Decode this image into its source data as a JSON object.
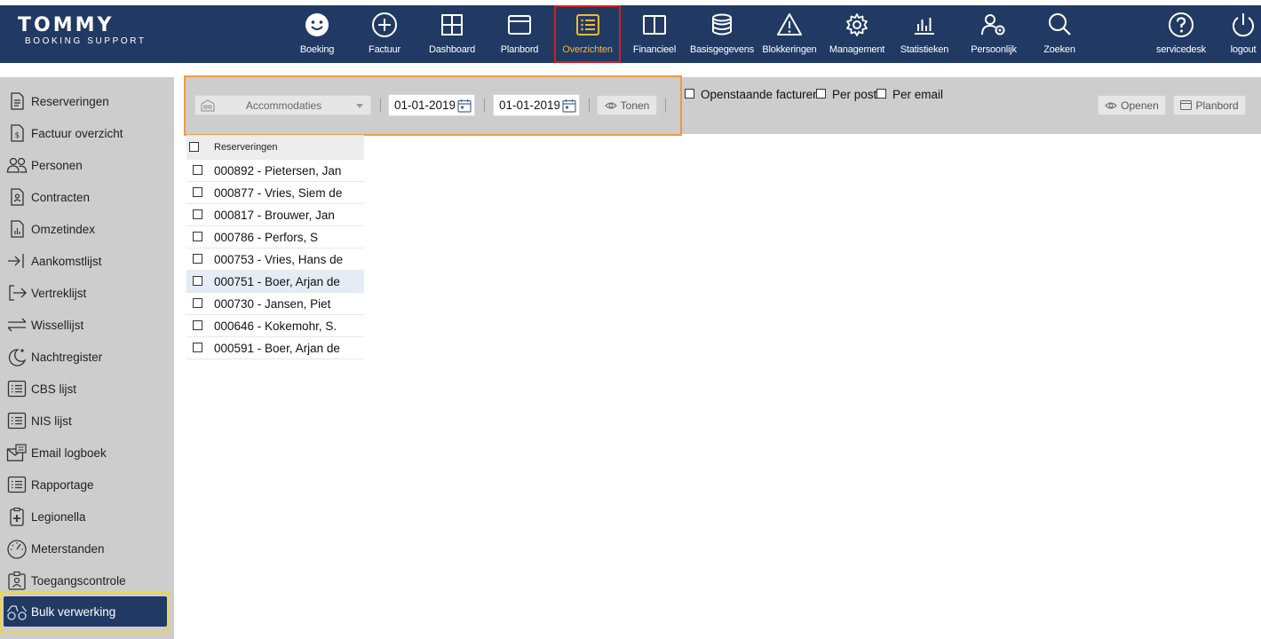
{
  "logo": {
    "main": "TOMMY",
    "sub": "BOOKING SUPPORT"
  },
  "nav": [
    {
      "label": "Boeking",
      "icon": "smiley-icon"
    },
    {
      "label": "Factuur",
      "icon": "plus-circle-icon"
    },
    {
      "label": "Dashboard",
      "icon": "grid-icon"
    },
    {
      "label": "Planbord",
      "icon": "window-icon"
    },
    {
      "label": "Overzichten",
      "icon": "list-icon",
      "active": true
    },
    {
      "label": "Financieel",
      "icon": "columns-icon"
    },
    {
      "label": "Basisgegevens",
      "icon": "database-icon"
    },
    {
      "label": "Blokkeringen",
      "icon": "warning-icon"
    },
    {
      "label": "Management",
      "icon": "gear-icon"
    },
    {
      "label": "Statistieken",
      "icon": "bar-chart-icon"
    },
    {
      "label": "Persoonlijk",
      "icon": "user-gear-icon"
    },
    {
      "label": "Zoeken",
      "icon": "search-icon"
    },
    {
      "label": "servicedesk",
      "icon": "help-icon"
    },
    {
      "label": "logout",
      "icon": "power-icon"
    }
  ],
  "sidebar": {
    "items": [
      {
        "label": "Reserveringen",
        "icon": "document-icon"
      },
      {
        "label": "Factuur overzicht",
        "icon": "invoice-icon"
      },
      {
        "label": "Personen",
        "icon": "people-icon"
      },
      {
        "label": "Contracten",
        "icon": "contract-icon"
      },
      {
        "label": "Omzetindex",
        "icon": "chart-document-icon"
      },
      {
        "label": "Aankomstlijst",
        "icon": "arrive-icon"
      },
      {
        "label": "Vertreklijst",
        "icon": "depart-icon"
      },
      {
        "label": "Wissellijst",
        "icon": "swap-icon"
      },
      {
        "label": "Nachtregister",
        "icon": "moon-icon"
      },
      {
        "label": "CBS lijst",
        "icon": "list-icon"
      },
      {
        "label": "NIS lijst",
        "icon": "list-icon"
      },
      {
        "label": "Email logboek",
        "icon": "email-icon"
      },
      {
        "label": "Rapportage",
        "icon": "list-icon"
      },
      {
        "label": "Legionella",
        "icon": "clipboard-plus-icon"
      },
      {
        "label": "Meterstanden",
        "icon": "gauge-icon"
      },
      {
        "label": "Toegangscontrole",
        "icon": "badge-icon"
      },
      {
        "label": "Bulk verwerking",
        "icon": "bulk-icon",
        "active": true
      }
    ]
  },
  "filters": {
    "accommodation_placeholder": "Accommodaties",
    "date_from": "01-01-2019",
    "date_to": "01-01-2019",
    "show_button": "Tonen",
    "open_invoices": "Openstaande facturen",
    "per_post": "Per post",
    "per_email": "Per email",
    "open_button": "Openen",
    "planbord_button": "Planbord"
  },
  "list": {
    "header": "Reserveringen",
    "rows": [
      "000892 - Pietersen, Jan",
      "000877 - Vries, Siem de",
      "000817 - Brouwer, Jan",
      "000786 - Perfors, S",
      "000753 - Vries, Hans de",
      "000751 - Boer, Arjan de",
      "000730 - Jansen, Piet",
      "000646 - Kokemohr, S.",
      "000591 - Boer, Arjan de"
    ],
    "selected_index": 5
  },
  "colors": {
    "topbar": "#213a63",
    "active_nav": "#f7b733",
    "sidebar_bg": "#cdcdcd",
    "active_side": "#213a63"
  }
}
